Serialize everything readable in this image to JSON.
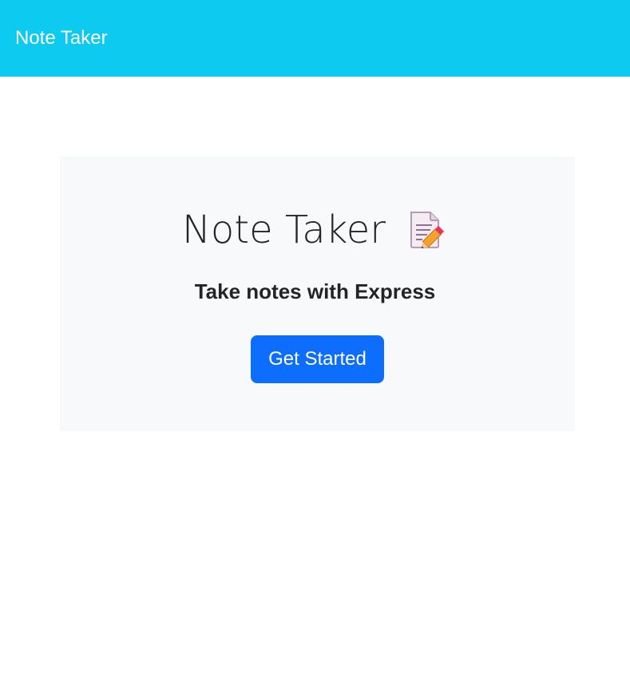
{
  "navbar": {
    "brand": "Note Taker",
    "background": "#0dcaf0"
  },
  "hero": {
    "title": "Note Taker",
    "icon": "memo-icon",
    "subtitle": "Take notes with Express",
    "button_label": "Get Started",
    "button_color": "#0d6efd",
    "panel_background": "#f8f9fa"
  }
}
